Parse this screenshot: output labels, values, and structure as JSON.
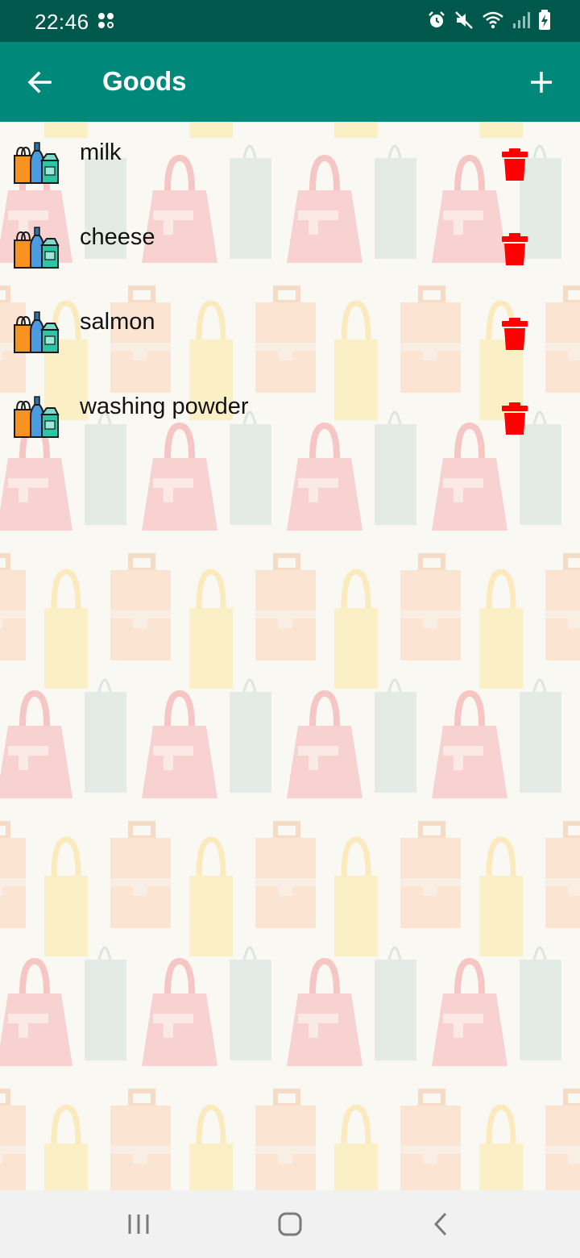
{
  "status_bar": {
    "time": "22:46",
    "icons": [
      "notification-dots-icon",
      "alarm-icon",
      "mute-icon",
      "wifi-icon",
      "signal-icon",
      "battery-charging-icon"
    ]
  },
  "app_bar": {
    "title": "Goods",
    "back_icon": "arrow-left-icon",
    "add_icon": "plus-icon",
    "background": "#00897b",
    "status_background": "#00574b"
  },
  "goods": [
    {
      "label": "milk"
    },
    {
      "label": "cheese"
    },
    {
      "label": "salmon"
    },
    {
      "label": "washing powder"
    }
  ],
  "delete_color": "#ff0000",
  "nav_bar": {
    "buttons": [
      "recent-apps-icon",
      "home-icon",
      "back-icon"
    ]
  }
}
